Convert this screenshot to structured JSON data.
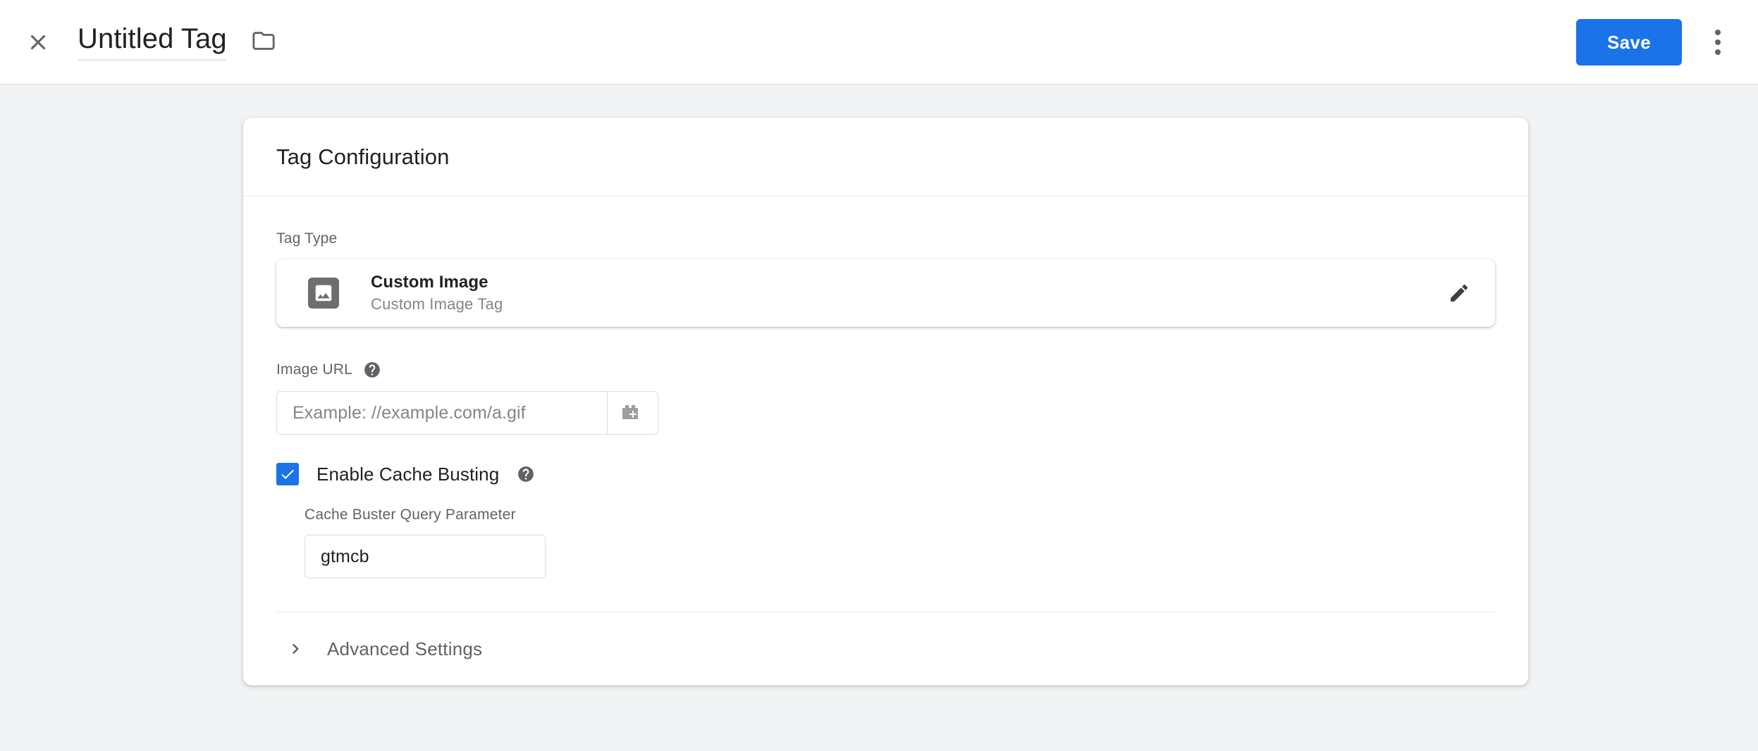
{
  "header": {
    "close_icon": "close-icon",
    "title": "Untitled Tag",
    "folder_icon": "folder-icon",
    "save_label": "Save",
    "more_icon": "more-vert-icon"
  },
  "card": {
    "title": "Tag Configuration",
    "tag_type": {
      "label": "Tag Type",
      "icon": "image-icon",
      "name": "Custom Image",
      "description": "Custom Image Tag",
      "edit_icon": "pencil-icon"
    },
    "image_url": {
      "label": "Image URL",
      "help_icon": "help-circle-icon",
      "value": "",
      "placeholder": "Example: //example.com/a.gif",
      "variable_icon": "insert-variable-icon"
    },
    "cache_busting": {
      "checked": true,
      "label": "Enable Cache Busting",
      "help_icon": "help-circle-icon",
      "param_label": "Cache Buster Query Parameter",
      "param_value": "gtmcb",
      "param_placeholder": "",
      "variable_icon": "insert-variable-icon"
    },
    "advanced": {
      "chevron_icon": "chevron-right-icon",
      "label": "Advanced Settings"
    }
  },
  "colors": {
    "accent": "#1a73e8",
    "page_background": "#f1f3f4",
    "card_background": "#ffffff",
    "text_primary": "#202124",
    "text_secondary": "#5f6368",
    "text_muted": "#80868b"
  }
}
